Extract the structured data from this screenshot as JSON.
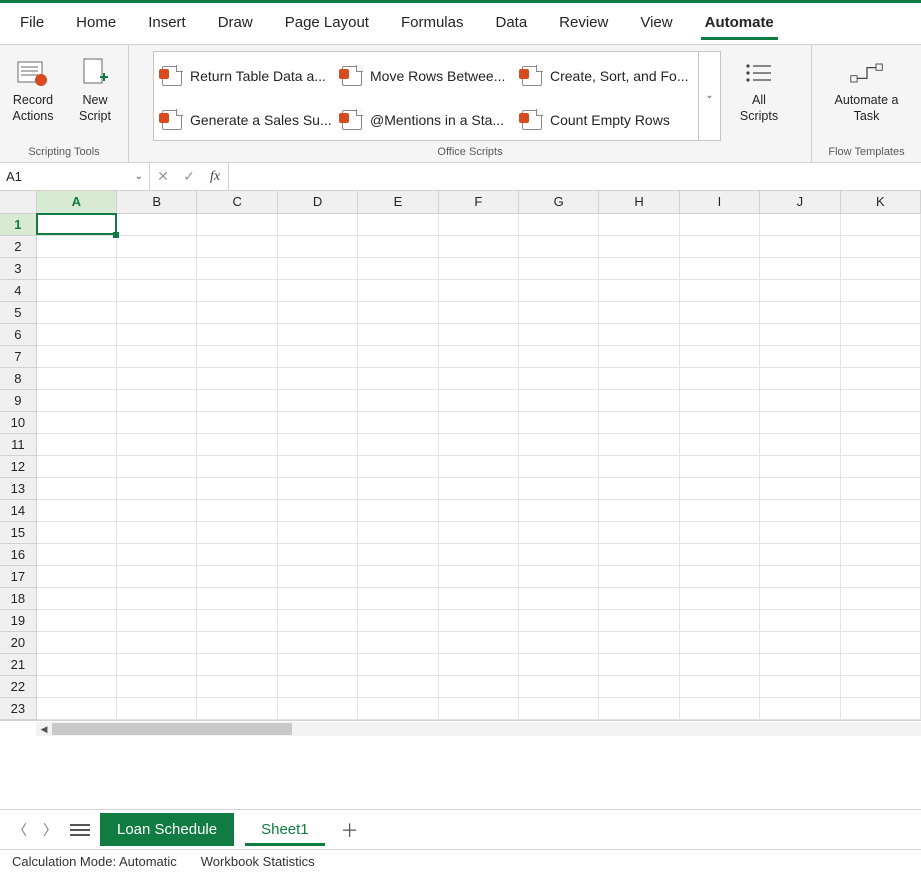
{
  "tabs": [
    "File",
    "Home",
    "Insert",
    "Draw",
    "Page Layout",
    "Formulas",
    "Data",
    "Review",
    "View",
    "Automate"
  ],
  "active_tab": "Automate",
  "ribbon": {
    "scripting": {
      "label": "Scripting Tools",
      "record": {
        "line1": "Record",
        "line2": "Actions"
      },
      "newscript": {
        "line1": "New",
        "line2": "Script"
      }
    },
    "office_scripts": {
      "label": "Office Scripts",
      "gallery": [
        "Return Table Data a...",
        "Move Rows Betwee...",
        "Create, Sort, and Fo...",
        "Generate a Sales Su...",
        "@Mentions in a Sta...",
        "Count Empty Rows"
      ],
      "all_scripts": {
        "line1": "All",
        "line2": "Scripts"
      }
    },
    "flow": {
      "label": "Flow Templates",
      "automate": {
        "line1": "Automate a",
        "line2": "Task"
      }
    }
  },
  "namebox_value": "A1",
  "formula_value": "",
  "columns": [
    "A",
    "B",
    "C",
    "D",
    "E",
    "F",
    "G",
    "H",
    "I",
    "J",
    "K"
  ],
  "rows": [
    "1",
    "2",
    "3",
    "4",
    "5",
    "6",
    "7",
    "8",
    "9",
    "10",
    "11",
    "12",
    "13",
    "14",
    "15",
    "16",
    "17",
    "18",
    "19",
    "20",
    "21",
    "22",
    "23"
  ],
  "selected_cell": "A1",
  "sheet_tabs": {
    "green": "Loan Schedule",
    "active": "Sheet1"
  },
  "statusbar": {
    "calc": "Calculation Mode: Automatic",
    "stats": "Workbook Statistics"
  }
}
